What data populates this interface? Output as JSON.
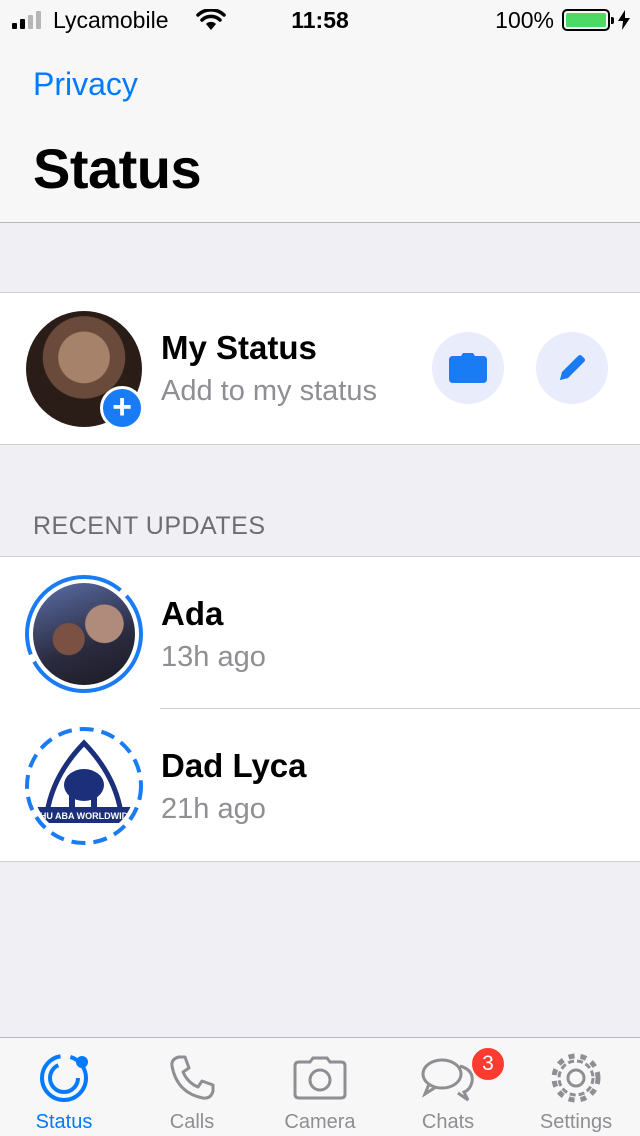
{
  "status_bar": {
    "carrier": "Lycamobile",
    "time": "11:58",
    "battery_percent": "100%",
    "battery_level": 1.0,
    "signal_bars_filled": 2,
    "icons": [
      "signal-icon",
      "wifi-icon",
      "battery-icon",
      "charging-icon"
    ]
  },
  "header": {
    "back_label": "Privacy",
    "title": "Status"
  },
  "my_status": {
    "name": "My Status",
    "subtitle": "Add to my status",
    "add_icon": "plus-icon",
    "actions": [
      "camera-icon",
      "pencil-icon"
    ]
  },
  "recent": {
    "header": "RECENT UPDATES",
    "items": [
      {
        "name": "Ada",
        "time": "13h ago"
      },
      {
        "name": "Dad Lyca",
        "time": "21h ago",
        "avatar_text": "HU ABA WORLDWIDE"
      }
    ]
  },
  "tabs": [
    {
      "label": "Status",
      "icon": "status-icon",
      "active": true
    },
    {
      "label": "Calls",
      "icon": "phone-icon",
      "active": false
    },
    {
      "label": "Camera",
      "icon": "camera-icon",
      "active": false
    },
    {
      "label": "Chats",
      "icon": "chat-bubbles-icon",
      "active": false,
      "badge": "3"
    },
    {
      "label": "Settings",
      "icon": "gear-icon",
      "active": false
    }
  ],
  "colors": {
    "accent": "#007aff",
    "badge": "#ff3b30",
    "battery": "#4cd964",
    "status_ring": "#1a7cf4"
  }
}
